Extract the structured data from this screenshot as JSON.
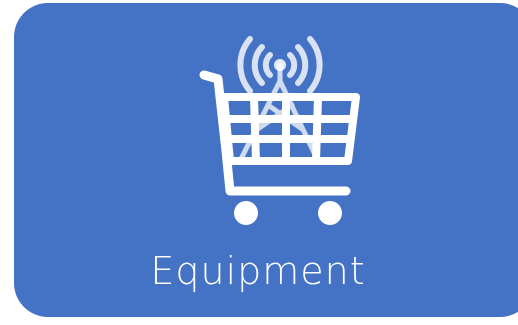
{
  "tile": {
    "label": "Equipment",
    "icon": "shopping-cart-with-antenna-tower-icon",
    "background_color": "#4472c4",
    "icon_color": "#ffffff"
  }
}
